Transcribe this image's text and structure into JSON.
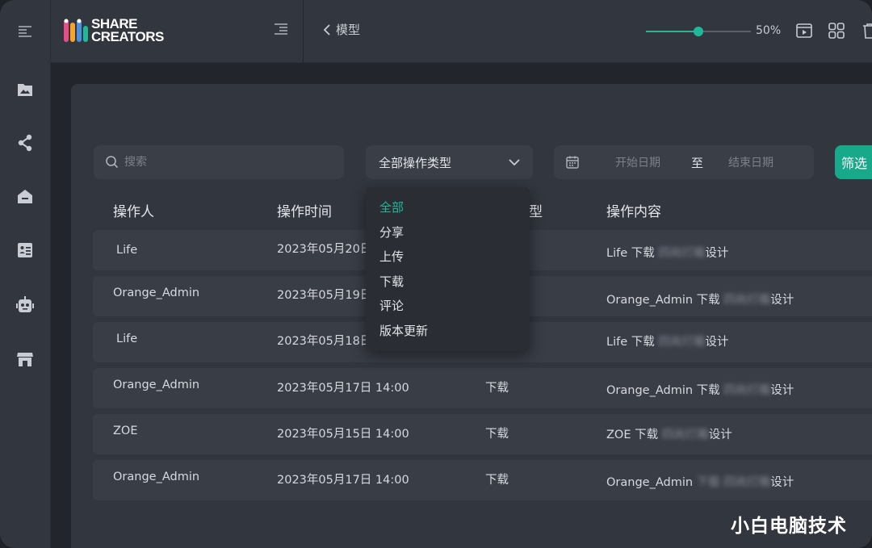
{
  "nav": {
    "icons": [
      "menu-icon",
      "images-icon",
      "share-icon",
      "home-icon",
      "contacts-icon",
      "robot-icon",
      "store-icon"
    ]
  },
  "brand": {
    "line1": "SHARE",
    "line2": "CREATORS"
  },
  "header": {
    "back_label": "模型",
    "zoom_label": "50%",
    "zoom_value": 0.5
  },
  "filters": {
    "search_placeholder": "搜索",
    "type_select": "全部操作类型",
    "start_date": "开始日期",
    "date_separator": "至",
    "end_date": "结束日期",
    "filter_button": "筛选"
  },
  "table": {
    "columns": [
      "操作人",
      "操作时间",
      "型",
      "操作内容"
    ],
    "rows": [
      {
        "operator": "Life",
        "time": "2023年05月20日",
        "type": "",
        "content_prefix": "Life    下载",
        "content_blur": "四尚灯箱",
        "content_suffix": "设计"
      },
      {
        "operator": "Orange_Admin",
        "time": "2023年05月19日",
        "type": "",
        "content_prefix": "Orange_Admin 下载",
        "content_blur": "四尚灯箱",
        "content_suffix": "设计"
      },
      {
        "operator": "Life",
        "time": "2023年05月18日",
        "type": "",
        "content_prefix": "Life 下载",
        "content_blur": "四尚灯箱",
        "content_suffix": "设计"
      },
      {
        "operator": "Orange_Admin",
        "time": "2023年05月17日 14:00",
        "type": "下载",
        "content_prefix": "Orange_Admin 下载",
        "content_blur": "四尚灯箱",
        "content_suffix": "设计"
      },
      {
        "operator": "ZOE",
        "time": "2023年05月15日 14:00",
        "type": "下载",
        "content_prefix": "ZOE 下载",
        "content_blur": "四尚灯箱",
        "content_suffix": "设计"
      },
      {
        "operator": "Orange_Admin",
        "time": "2023年05月17日 14:00",
        "type": "下载",
        "content_prefix": "Orange_Admin",
        "content_blur": "下载 四尚灯箱",
        "content_suffix": "设计"
      }
    ]
  },
  "dropdown": {
    "options": [
      "全部",
      "分享",
      "上传",
      "下载",
      "评论",
      "版本更新"
    ],
    "active_index": 0
  },
  "watermark": "小白电脑技术",
  "colors": {
    "accent": "#1fb99a",
    "panel": "#32363e",
    "row": "#393d46"
  }
}
